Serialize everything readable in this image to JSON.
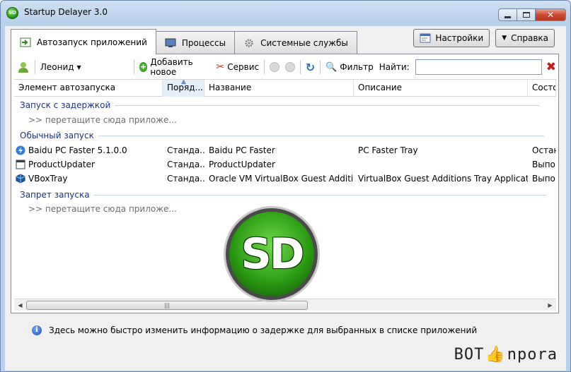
{
  "window": {
    "title": "Startup Delayer 3.0",
    "icon_text": "SD"
  },
  "tabs": [
    {
      "label": "Автозапуск приложений",
      "icon": "startup-icon",
      "active": true
    },
    {
      "label": "Процессы",
      "icon": "processes-icon",
      "active": false
    },
    {
      "label": "Системные службы",
      "icon": "services-gear-icon",
      "active": false
    }
  ],
  "right_buttons": {
    "settings": "Настройки",
    "help": "Справка"
  },
  "toolbar": {
    "user": "Леонид",
    "add_new": "Добавить новое",
    "service": "Сервис",
    "filter": "Фильтр",
    "find_label": "Найти:",
    "find_value": ""
  },
  "columns": [
    "Элемент автозапуска",
    "Поряд...",
    "Название",
    "Описание",
    "Состо..."
  ],
  "groups": {
    "delayed": "Запуск с задержкой",
    "normal": "Обычный запуск",
    "disabled": "Запрет запуска",
    "drop_hint": ">> перетащите сюда приложе..."
  },
  "rows": [
    {
      "name": "Baidu PC Faster 5.1.0.0",
      "order": "Станда...",
      "title": "Baidu PC Faster",
      "description": "PC Faster Tray",
      "state": "Остан...",
      "icon": "baidu-icon"
    },
    {
      "name": "ProductUpdater",
      "order": "Станда...",
      "title": "ProductUpdater",
      "description": "",
      "state": "Выпо...",
      "icon": "updater-icon"
    },
    {
      "name": "VBoxTray",
      "order": "Станда...",
      "title": "Oracle VM VirtualBox Guest Additions",
      "description": "VirtualBox Guest Additions Tray Application",
      "state": "Выпо...",
      "icon": "virtualbox-icon"
    }
  ],
  "logo": {
    "text": "SD"
  },
  "info": {
    "text": "Здесь можно быстро изменить информацию о задержке для выбранных в списке приложений"
  },
  "watermark": {
    "left": "BOT",
    "right": "npora"
  },
  "colors": {
    "group_text": "#1e3287",
    "logo_green": "#2d9d14",
    "close_red": "#c94a31"
  }
}
